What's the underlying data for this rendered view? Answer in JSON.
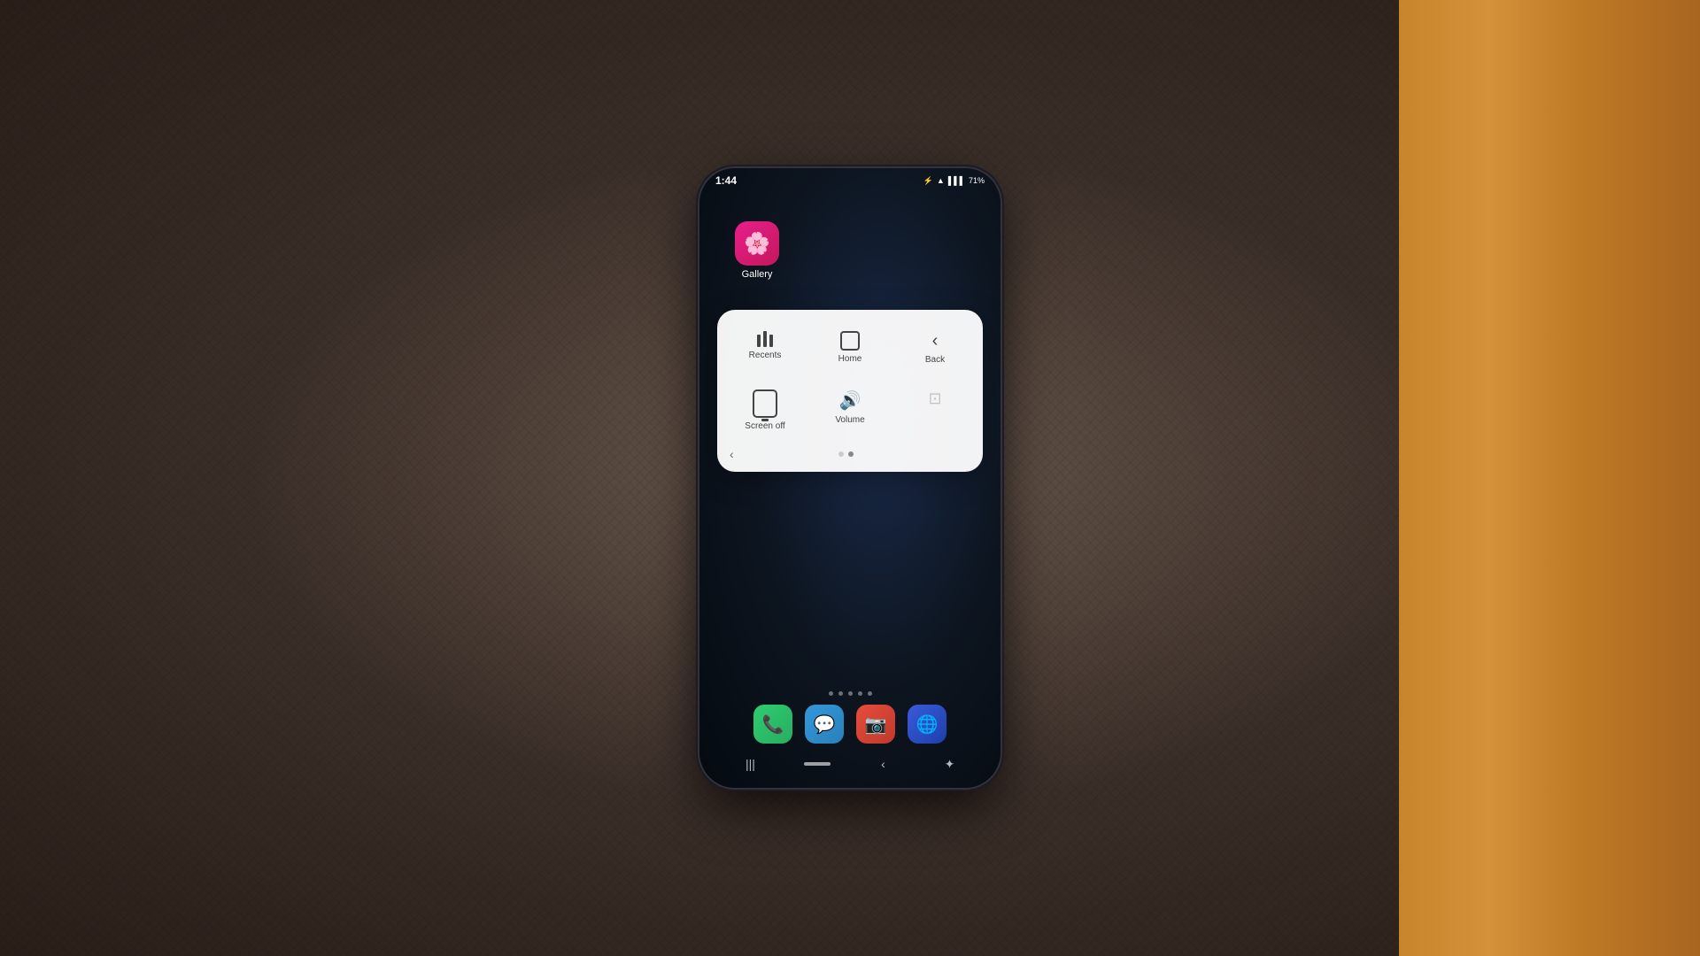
{
  "scene": {
    "background": "dark woven mat with wooden surface on right"
  },
  "phone": {
    "status_bar": {
      "time": "1:44",
      "battery": "71%",
      "icons": [
        "bluetooth",
        "wifi",
        "signal",
        "battery"
      ]
    },
    "gallery_app": {
      "label": "Gallery",
      "icon": "🌸"
    },
    "nav_panel": {
      "row1": [
        {
          "id": "recents",
          "label": "Recents",
          "icon": "recents"
        },
        {
          "id": "home",
          "label": "Home",
          "icon": "home"
        },
        {
          "id": "back",
          "label": "Back",
          "icon": "back"
        }
      ],
      "row2": [
        {
          "id": "screen-off",
          "label": "Screen off",
          "icon": "screen-off"
        },
        {
          "id": "volume",
          "label": "Volume",
          "icon": "volume"
        },
        {
          "id": "more",
          "label": "",
          "icon": "more"
        }
      ],
      "pagination": {
        "dots": [
          false,
          true
        ],
        "arrow_left": "‹"
      }
    },
    "dock": {
      "page_dots": 5,
      "apps": [
        {
          "id": "phone",
          "icon": "📞",
          "label": "Phone"
        },
        {
          "id": "messages",
          "icon": "💬",
          "label": "Messages"
        },
        {
          "id": "camera",
          "icon": "📷",
          "label": "Camera"
        },
        {
          "id": "browser",
          "icon": "🌐",
          "label": "Browser"
        }
      ]
    },
    "bottom_nav": {
      "recents_icon": "|||",
      "home_pill": true,
      "back_icon": "‹",
      "bixby_icon": "✦"
    }
  }
}
